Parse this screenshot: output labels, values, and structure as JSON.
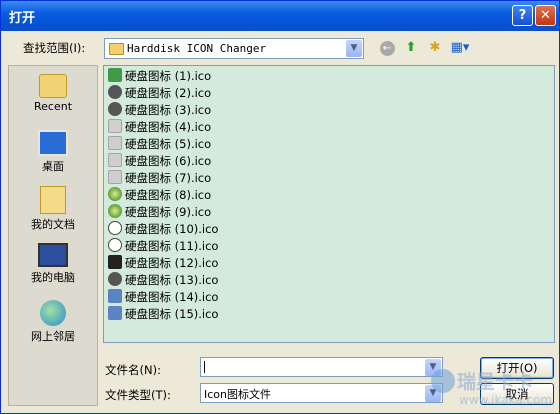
{
  "window": {
    "title": "打开",
    "help": "?",
    "close": "✕"
  },
  "lookin": {
    "label": "查找范围(I):",
    "value": "Harddisk ICON Changer"
  },
  "toolbar": {
    "back": "←",
    "up": "⬆",
    "new_folder": "✱",
    "views": "▦▾"
  },
  "places": [
    {
      "label": "Recent",
      "icon": "recent-folder-icon"
    },
    {
      "label": "桌面",
      "icon": "desktop-icon"
    },
    {
      "label": "我的文档",
      "icon": "my-documents-icon"
    },
    {
      "label": "我的电脑",
      "icon": "my-computer-icon"
    },
    {
      "label": "网上邻居",
      "icon": "network-places-icon"
    }
  ],
  "files": [
    {
      "name": "硬盘图标 (1).ico",
      "icon": "green-drive-icon"
    },
    {
      "name": "硬盘图标 (2).ico",
      "icon": "dark-drive-icon"
    },
    {
      "name": "硬盘图标 (3).ico",
      "icon": "dark-drive-icon"
    },
    {
      "name": "硬盘图标 (4).ico",
      "icon": "gray-drive-icon"
    },
    {
      "name": "硬盘图标 (5).ico",
      "icon": "gray-drive-icon"
    },
    {
      "name": "硬盘图标 (6).ico",
      "icon": "gray-drive-icon"
    },
    {
      "name": "硬盘图标 (7).ico",
      "icon": "gray-drive-icon"
    },
    {
      "name": "硬盘图标 (8).ico",
      "icon": "globe-drive-icon"
    },
    {
      "name": "硬盘图标 (9).ico",
      "icon": "globe-drive-icon"
    },
    {
      "name": "硬盘图标 (10).ico",
      "icon": "clock-drive-icon"
    },
    {
      "name": "硬盘图标 (11).ico",
      "icon": "clock-drive-icon"
    },
    {
      "name": "硬盘图标 (12).ico",
      "icon": "black-drive-icon"
    },
    {
      "name": "硬盘图标 (13).ico",
      "icon": "dark-drive-icon"
    },
    {
      "name": "硬盘图标 (14).ico",
      "icon": "blue-drive-icon"
    },
    {
      "name": "硬盘图标 (15).ico",
      "icon": "blue-drive-icon"
    }
  ],
  "filename": {
    "label": "文件名(N):",
    "value": ""
  },
  "filetype": {
    "label": "文件类型(T):",
    "value": "Icon图标文件"
  },
  "buttons": {
    "open": "打开(O)",
    "cancel": "取消"
  },
  "watermark": {
    "brand": "瑞星卡卡",
    "url": "www.ikaka.com"
  }
}
